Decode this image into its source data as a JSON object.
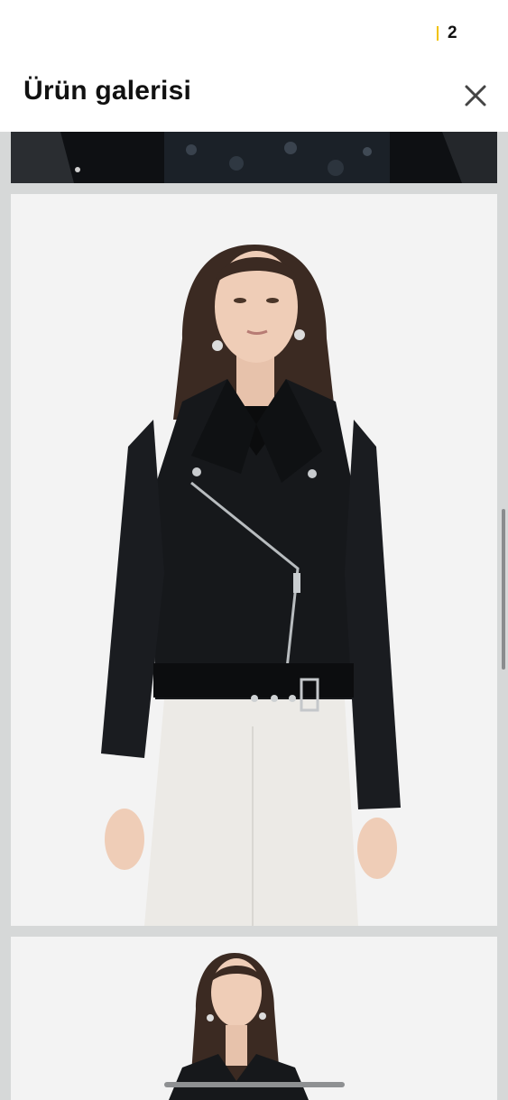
{
  "status": {
    "count": "2"
  },
  "header": {
    "title": "Ürün galerisi"
  },
  "icons": {
    "close": "close-icon"
  },
  "colors": {
    "background": "#ffffff",
    "gallery_bg": "#d6d8d8",
    "jacket": "#16181b",
    "trousers": "#eceae6",
    "indicator": "#f2c200"
  }
}
